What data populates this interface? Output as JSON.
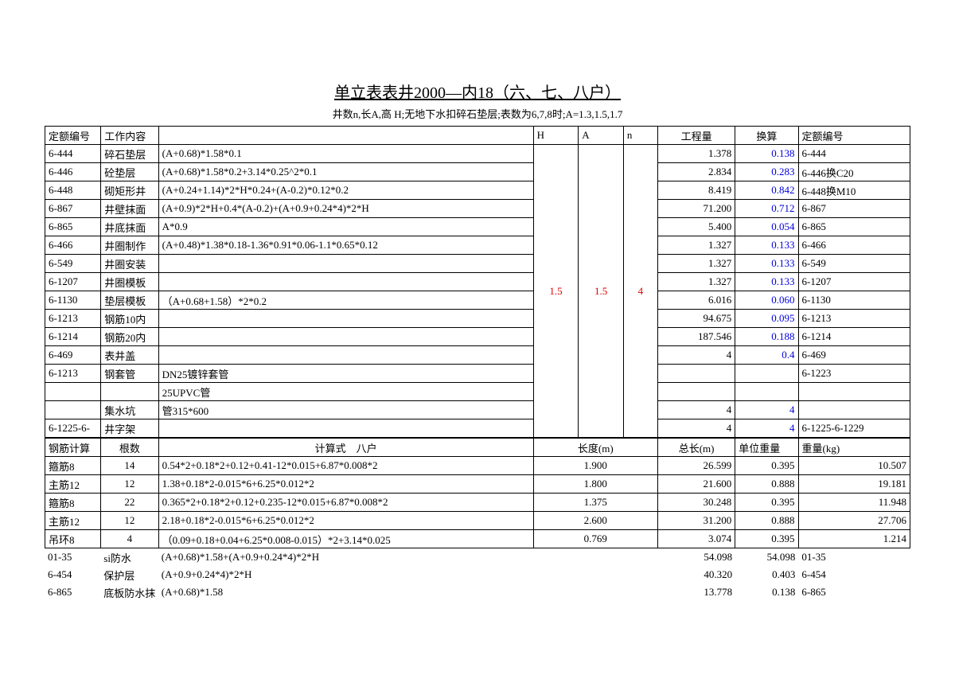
{
  "title": "单立表表井2000—内18（六、七、八户）",
  "subtitle": "井数n,长A,高 H;无地下水扣碎石垫层;表数为6,7,8时;A=1.3,1.5,1.7",
  "hdr": {
    "c1": "定额编号",
    "c2": "工作内容",
    "c3": "",
    "c4": "H",
    "c5": "A",
    "c6": "n",
    "c7": "工程量",
    "c8": "换算",
    "c9": "定额编号"
  },
  "H": "1.5",
  "A": "1.5",
  "n": "4",
  "rows": [
    {
      "a": "6-444",
      "b": "碎石垫层",
      "f": "(A+0.68)*1.58*0.1",
      "q": "1.378",
      "v": "0.138",
      "c": "6-444"
    },
    {
      "a": "6-446",
      "b": "砼垫层",
      "f": "(A+0.68)*1.58*0.2+3.14*0.25^2*0.1",
      "q": "2.834",
      "v": "0.283",
      "c": "6-446换C20"
    },
    {
      "a": "6-448",
      "b": "砌矩形井",
      "f": "(A+0.24+1.14)*2*H*0.24+(A-0.2)*0.12*0.2",
      "q": "8.419",
      "v": "0.842",
      "c": "6-448换M10"
    },
    {
      "a": "6-867",
      "b": "井壁抹面",
      "f": "(A+0.9)*2*H+0.4*(A-0.2)+(A+0.9+0.24*4)*2*H",
      "q": "71.200",
      "v": "0.712",
      "c": "6-867"
    },
    {
      "a": "6-865",
      "b": "井底抹面",
      "f": "A*0.9",
      "q": "5.400",
      "v": "0.054",
      "c": "6-865"
    },
    {
      "a": "6-466",
      "b": "井圈制作",
      "f": "(A+0.48)*1.38*0.18-1.36*0.91*0.06-1.1*0.65*0.12",
      "q": "1.327",
      "v": "0.133",
      "c": "6-466"
    },
    {
      "a": "6-549",
      "b": "井圈安装",
      "f": "",
      "q": "1.327",
      "v": "0.133",
      "c": "6-549"
    },
    {
      "a": "6-1207",
      "b": "井圈模板",
      "f": "",
      "q": "1.327",
      "v": "0.133",
      "c": "6-1207"
    },
    {
      "a": "6-1130",
      "b": "垫层模板",
      "f": "（A+0.68+1.58）*2*0.2",
      "q": "6.016",
      "v": "0.060",
      "c": "6-1130"
    },
    {
      "a": "6-1213",
      "b": "钢筋10内",
      "f": "",
      "q": "94.675",
      "v": "0.095",
      "c": "6-1213"
    },
    {
      "a": "6-1214",
      "b": "钢筋20内",
      "f": "",
      "q": "187.546",
      "v": "0.188",
      "c": "6-1214"
    },
    {
      "a": "6-469",
      "b": "表井盖",
      "f": "",
      "q": "4",
      "v": "0.4",
      "c": "6-469"
    },
    {
      "a": "6-1213",
      "b": "钢套管",
      "f": "DN25镀锌套管",
      "q": "",
      "v": "",
      "c": "6-1223"
    },
    {
      "a": "",
      "b": "",
      "f": "25UPVC管",
      "q": "",
      "v": "",
      "c": ""
    },
    {
      "a": "",
      "b": "集水坑",
      "f": "管315*600",
      "q": "4",
      "v": "4",
      "c": ""
    },
    {
      "a": "6-1225-6-",
      "b": "井字架",
      "f": "",
      "q": "4",
      "v": "4",
      "c": "6-1225-6-1229"
    }
  ],
  "hdr2": {
    "c1": "钢筋计算",
    "c2": "根数",
    "c3": "计算式",
    "c3b": "八户",
    "c4": "长度(m)",
    "c5": "总长(m)",
    "c6": "单位重量",
    "c7": "重量(kg)"
  },
  "rebar": [
    {
      "a": "箍筋8",
      "n": "14",
      "f": "0.54*2+0.18*2+0.12+0.41-12*0.015+6.87*0.008*2",
      "l": "1.900",
      "t": "26.599",
      "w": "0.395",
      "m": "10.507"
    },
    {
      "a": "主筋12",
      "n": "12",
      "f": "1.38+0.18*2-0.015*6+6.25*0.012*2",
      "l": "1.800",
      "t": "21.600",
      "w": "0.888",
      "m": "19.181"
    },
    {
      "a": "箍筋8",
      "n": "22",
      "f": "0.365*2+0.18*2+0.12+0.235-12*0.015+6.87*0.008*2",
      "l": "1.375",
      "t": "30.248",
      "w": "0.395",
      "m": "11.948"
    },
    {
      "a": "主筋12",
      "n": "12",
      "f": "2.18+0.18*2-0.015*6+6.25*0.012*2",
      "l": "2.600",
      "t": "31.200",
      "w": "0.888",
      "m": "27.706"
    },
    {
      "a": "吊环8",
      "n": "4",
      "f": "（0.09+0.18+0.04+6.25*0.008-0.015）*2+3.14*0.025",
      "l": "0.769",
      "t": "3.074",
      "w": "0.395",
      "m": "1.214"
    }
  ],
  "footer": [
    {
      "a": "01-35",
      "b": "si防水",
      "f": "(A+0.68)*1.58+(A+0.9+0.24*4)*2*H",
      "t": "54.098",
      "w": "54.098",
      "c": "01-35"
    },
    {
      "a": "6-454",
      "b": "保护层",
      "f": "(A+0.9+0.24*4)*2*H",
      "t": "40.320",
      "w": "0.403",
      "c": "6-454"
    },
    {
      "a": "6-865",
      "b": "底板防水抹",
      "f": "(A+0.68)*1.58",
      "t": "13.778",
      "w": "0.138",
      "c": "6-865"
    }
  ]
}
